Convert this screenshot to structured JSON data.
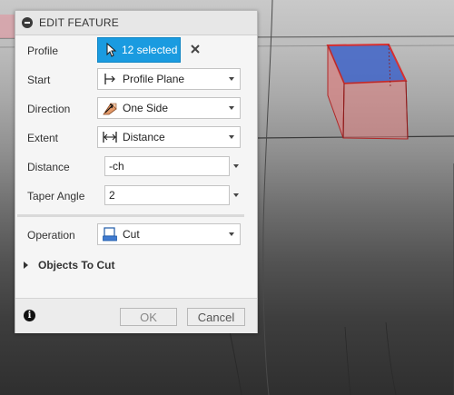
{
  "dialog": {
    "title": "EDIT FEATURE",
    "profile": {
      "label": "Profile",
      "value": "12 selected"
    },
    "start": {
      "label": "Start",
      "value": "Profile Plane",
      "icon": "profile-plane-icon"
    },
    "direction": {
      "label": "Direction",
      "value": "One Side",
      "icon": "one-side-icon"
    },
    "extent": {
      "label": "Extent",
      "value": "Distance",
      "icon": "distance-icon"
    },
    "distance": {
      "label": "Distance",
      "value": "-ch"
    },
    "taper_angle": {
      "label": "Taper Angle",
      "value": "2"
    },
    "operation": {
      "label": "Operation",
      "value": "Cut",
      "icon": "cut-icon"
    },
    "objects_to_cut": {
      "label": "Objects To Cut",
      "expanded": false
    },
    "buttons": {
      "ok": "OK",
      "cancel": "Cancel"
    }
  },
  "colors": {
    "accent": "#1a9be0",
    "selection_fill": "#3f64c8",
    "preview_fill": "#d98080",
    "preview_edge": "#b02828"
  }
}
